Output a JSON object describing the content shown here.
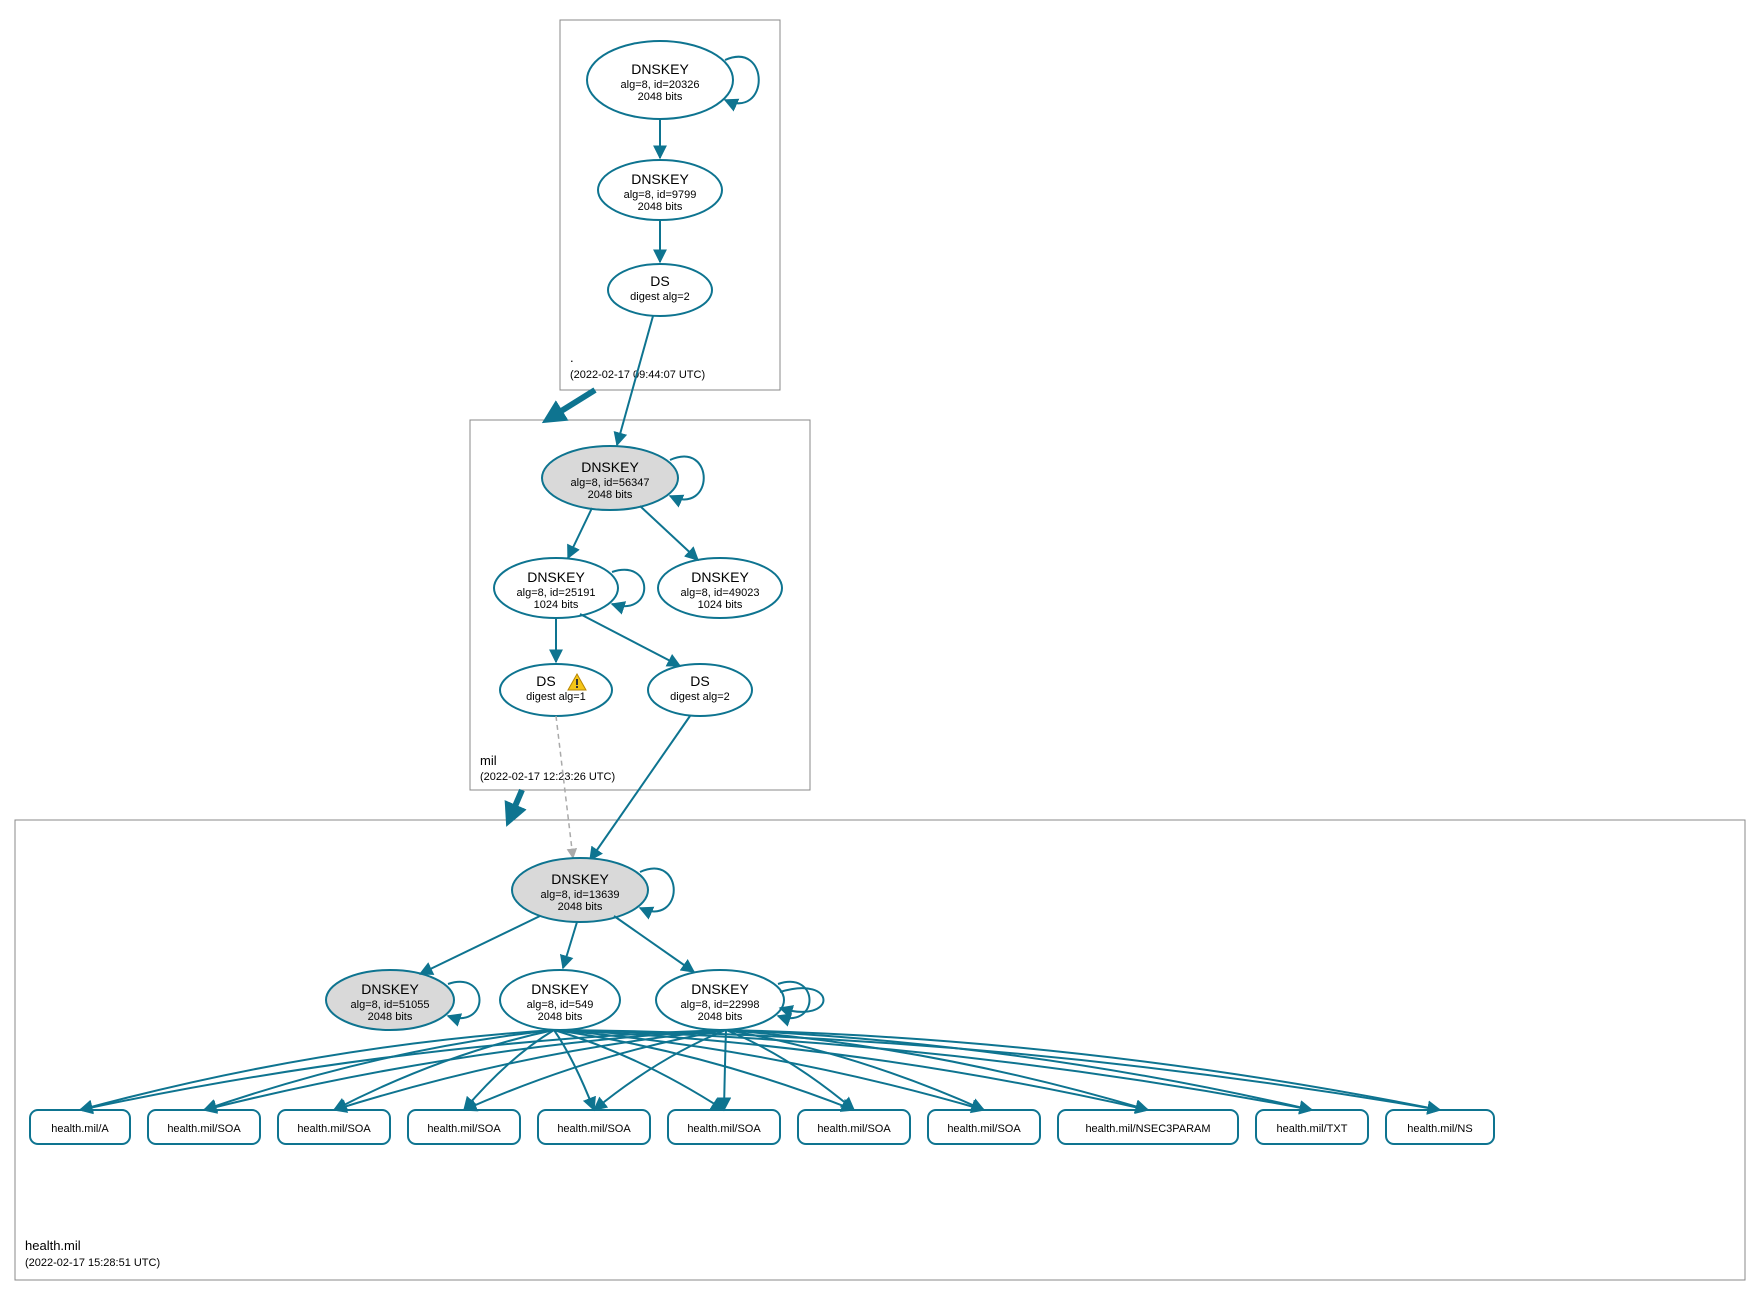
{
  "zones": {
    "root": {
      "label": ".",
      "timestamp": "(2022-02-17 09:44:07 UTC)"
    },
    "mil": {
      "label": "mil",
      "timestamp": "(2022-02-17 12:23:26 UTC)"
    },
    "health": {
      "label": "health.mil",
      "timestamp": "(2022-02-17 15:28:51 UTC)"
    }
  },
  "nodes": {
    "root_ksk": {
      "title": "DNSKEY",
      "line2": "alg=8, id=20326",
      "line3": "2048 bits"
    },
    "root_zsk": {
      "title": "DNSKEY",
      "line2": "alg=8, id=9799",
      "line3": "2048 bits"
    },
    "root_ds": {
      "title": "DS",
      "line2": "digest alg=2"
    },
    "mil_ksk": {
      "title": "DNSKEY",
      "line2": "alg=8, id=56347",
      "line3": "2048 bits"
    },
    "mil_zsk": {
      "title": "DNSKEY",
      "line2": "alg=8, id=25191",
      "line3": "1024 bits"
    },
    "mil_zsk2": {
      "title": "DNSKEY",
      "line2": "alg=8, id=49023",
      "line3": "1024 bits"
    },
    "mil_ds1": {
      "title": "DS",
      "line2": "digest alg=1"
    },
    "mil_ds2": {
      "title": "DS",
      "line2": "digest alg=2"
    },
    "health_ksk": {
      "title": "DNSKEY",
      "line2": "alg=8, id=13639",
      "line3": "2048 bits"
    },
    "health_zsk1": {
      "title": "DNSKEY",
      "line2": "alg=8, id=51055",
      "line3": "2048 bits"
    },
    "health_zsk2": {
      "title": "DNSKEY",
      "line2": "alg=8, id=549",
      "line3": "2048 bits"
    },
    "health_zsk3": {
      "title": "DNSKEY",
      "line2": "alg=8, id=22998",
      "line3": "2048 bits"
    },
    "rr0": {
      "label": "health.mil/A"
    },
    "rr1": {
      "label": "health.mil/SOA"
    },
    "rr2": {
      "label": "health.mil/SOA"
    },
    "rr3": {
      "label": "health.mil/SOA"
    },
    "rr4": {
      "label": "health.mil/SOA"
    },
    "rr5": {
      "label": "health.mil/SOA"
    },
    "rr6": {
      "label": "health.mil/SOA"
    },
    "rr7": {
      "label": "health.mil/SOA"
    },
    "rr8": {
      "label": "health.mil/NSEC3PARAM"
    },
    "rr9": {
      "label": "health.mil/TXT"
    },
    "rr10": {
      "label": "health.mil/NS"
    }
  },
  "chart_data": {
    "type": "graph",
    "description": "DNSSEC authentication chain / DNSViz graph for health.mil",
    "zones": [
      {
        "name": ".",
        "timestamp": "2022-02-17 09:44:07 UTC"
      },
      {
        "name": "mil",
        "timestamp": "2022-02-17 12:23:26 UTC"
      },
      {
        "name": "health.mil",
        "timestamp": "2022-02-17 15:28:51 UTC"
      }
    ],
    "records": [
      {
        "id": "root_ksk",
        "zone": ".",
        "type": "DNSKEY",
        "alg": 8,
        "key_id": 20326,
        "bits": 2048,
        "ksk": true,
        "sep": true
      },
      {
        "id": "root_zsk",
        "zone": ".",
        "type": "DNSKEY",
        "alg": 8,
        "key_id": 9799,
        "bits": 2048
      },
      {
        "id": "root_ds",
        "zone": ".",
        "type": "DS",
        "digest_alg": 2
      },
      {
        "id": "mil_ksk",
        "zone": "mil",
        "type": "DNSKEY",
        "alg": 8,
        "key_id": 56347,
        "bits": 2048,
        "ksk": true
      },
      {
        "id": "mil_zsk",
        "zone": "mil",
        "type": "DNSKEY",
        "alg": 8,
        "key_id": 25191,
        "bits": 1024
      },
      {
        "id": "mil_zsk2",
        "zone": "mil",
        "type": "DNSKEY",
        "alg": 8,
        "key_id": 49023,
        "bits": 1024
      },
      {
        "id": "mil_ds1",
        "zone": "mil",
        "type": "DS",
        "digest_alg": 1,
        "warning": true
      },
      {
        "id": "mil_ds2",
        "zone": "mil",
        "type": "DS",
        "digest_alg": 2
      },
      {
        "id": "health_ksk",
        "zone": "health.mil",
        "type": "DNSKEY",
        "alg": 8,
        "key_id": 13639,
        "bits": 2048,
        "ksk": true
      },
      {
        "id": "health_zsk1",
        "zone": "health.mil",
        "type": "DNSKEY",
        "alg": 8,
        "key_id": 51055,
        "bits": 2048
      },
      {
        "id": "health_zsk2",
        "zone": "health.mil",
        "type": "DNSKEY",
        "alg": 8,
        "key_id": 549,
        "bits": 2048
      },
      {
        "id": "health_zsk3",
        "zone": "health.mil",
        "type": "DNSKEY",
        "alg": 8,
        "key_id": 22998,
        "bits": 2048
      },
      {
        "id": "rr0",
        "zone": "health.mil",
        "type": "RRset",
        "name": "health.mil/A"
      },
      {
        "id": "rr1",
        "zone": "health.mil",
        "type": "RRset",
        "name": "health.mil/SOA"
      },
      {
        "id": "rr2",
        "zone": "health.mil",
        "type": "RRset",
        "name": "health.mil/SOA"
      },
      {
        "id": "rr3",
        "zone": "health.mil",
        "type": "RRset",
        "name": "health.mil/SOA"
      },
      {
        "id": "rr4",
        "zone": "health.mil",
        "type": "RRset",
        "name": "health.mil/SOA"
      },
      {
        "id": "rr5",
        "zone": "health.mil",
        "type": "RRset",
        "name": "health.mil/SOA"
      },
      {
        "id": "rr6",
        "zone": "health.mil",
        "type": "RRset",
        "name": "health.mil/SOA"
      },
      {
        "id": "rr7",
        "zone": "health.mil",
        "type": "RRset",
        "name": "health.mil/SOA"
      },
      {
        "id": "rr8",
        "zone": "health.mil",
        "type": "RRset",
        "name": "health.mil/NSEC3PARAM"
      },
      {
        "id": "rr9",
        "zone": "health.mil",
        "type": "RRset",
        "name": "health.mil/TXT"
      },
      {
        "id": "rr10",
        "zone": "health.mil",
        "type": "RRset",
        "name": "health.mil/NS"
      }
    ],
    "edges": [
      {
        "from": "root_ksk",
        "to": "root_ksk",
        "kind": "self-sign"
      },
      {
        "from": "root_ksk",
        "to": "root_zsk"
      },
      {
        "from": "root_zsk",
        "to": "root_ds"
      },
      {
        "from": "root_ds",
        "to": "mil_ksk"
      },
      {
        "from": "mil_ksk",
        "to": "mil_ksk",
        "kind": "self-sign"
      },
      {
        "from": "mil_ksk",
        "to": "mil_zsk"
      },
      {
        "from": "mil_ksk",
        "to": "mil_zsk2"
      },
      {
        "from": "mil_zsk",
        "to": "mil_zsk",
        "kind": "self-sign"
      },
      {
        "from": "mil_zsk",
        "to": "mil_ds1"
      },
      {
        "from": "mil_zsk",
        "to": "mil_ds2"
      },
      {
        "from": "mil_ds1",
        "to": "health_ksk",
        "style": "dashed"
      },
      {
        "from": "mil_ds2",
        "to": "health_ksk"
      },
      {
        "from": "health_ksk",
        "to": "health_ksk",
        "kind": "self-sign"
      },
      {
        "from": "health_ksk",
        "to": "health_zsk1"
      },
      {
        "from": "health_ksk",
        "to": "health_zsk2"
      },
      {
        "from": "health_ksk",
        "to": "health_zsk3"
      },
      {
        "from": "health_zsk1",
        "to": "health_zsk1",
        "kind": "self-sign"
      },
      {
        "from": "health_zsk3",
        "to": "health_zsk3",
        "kind": "self-sign"
      },
      {
        "from": "health_zsk2",
        "to": "rr0"
      },
      {
        "from": "health_zsk3",
        "to": "rr0"
      },
      {
        "from": "health_zsk2",
        "to": "rr1"
      },
      {
        "from": "health_zsk3",
        "to": "rr1"
      },
      {
        "from": "health_zsk2",
        "to": "rr2"
      },
      {
        "from": "health_zsk3",
        "to": "rr2"
      },
      {
        "from": "health_zsk2",
        "to": "rr3"
      },
      {
        "from": "health_zsk3",
        "to": "rr3"
      },
      {
        "from": "health_zsk2",
        "to": "rr4"
      },
      {
        "from": "health_zsk3",
        "to": "rr4"
      },
      {
        "from": "health_zsk2",
        "to": "rr5"
      },
      {
        "from": "health_zsk3",
        "to": "rr5"
      },
      {
        "from": "health_zsk2",
        "to": "rr6"
      },
      {
        "from": "health_zsk3",
        "to": "rr6"
      },
      {
        "from": "health_zsk2",
        "to": "rr7"
      },
      {
        "from": "health_zsk3",
        "to": "rr7"
      },
      {
        "from": "health_zsk2",
        "to": "rr8"
      },
      {
        "from": "health_zsk3",
        "to": "rr8"
      },
      {
        "from": "health_zsk2",
        "to": "rr9"
      },
      {
        "from": "health_zsk3",
        "to": "rr9"
      },
      {
        "from": "health_zsk2",
        "to": "rr10"
      },
      {
        "from": "health_zsk3",
        "to": "rr10"
      }
    ]
  }
}
